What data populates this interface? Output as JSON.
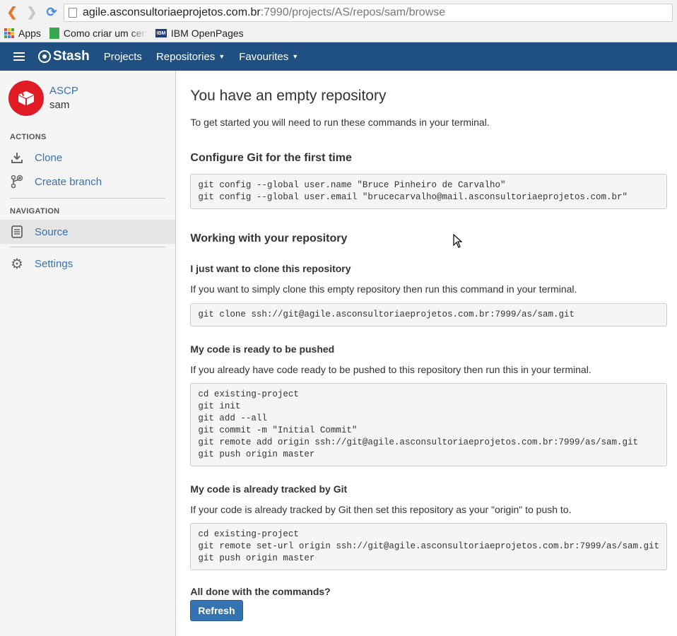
{
  "browser": {
    "url_host": "agile.asconsultoriaeprojetos.com.br",
    "url_path": ":7990/projects/AS/repos/sam/browse",
    "bookmarks": [
      {
        "label": "Apps",
        "icon": "apps-grid-icon"
      },
      {
        "label": "Como criar um cert",
        "icon": "sheets-icon"
      },
      {
        "label": "IBM OpenPages",
        "icon": "ibm-icon"
      }
    ]
  },
  "header": {
    "logo": "Stash",
    "nav": [
      {
        "label": "Projects"
      },
      {
        "label": "Repositories"
      },
      {
        "label": "Favourites"
      }
    ],
    "color": "#205081"
  },
  "sidebar": {
    "project": "ASCP",
    "repo": "sam",
    "actions_title": "ACTIONS",
    "actions": [
      {
        "label": "Clone",
        "icon": "clone-icon"
      },
      {
        "label": "Create branch",
        "icon": "create-branch-icon"
      }
    ],
    "navigation_title": "NAVIGATION",
    "navigation": [
      {
        "label": "Source",
        "icon": "source-icon",
        "active": true
      },
      {
        "label": "Settings",
        "icon": "gear-icon"
      }
    ],
    "avatar_color": "#e01b24"
  },
  "main": {
    "title": "You have an empty repository",
    "intro": "To get started you will need to run these commands in your terminal.",
    "configure": {
      "heading": "Configure Git for the first time",
      "code": "git config --global user.name \"Bruce Pinheiro de Carvalho\"\ngit config --global user.email \"brucecarvalho@mail.asconsultoriaeprojetos.com.br\""
    },
    "working_heading": "Working with your repository",
    "clone": {
      "heading": "I just want to clone this repository",
      "desc": "If you want to simply clone this empty repository then run this command in your terminal.",
      "code": "git clone ssh://git@agile.asconsultoriaeprojetos.com.br:7999/as/sam.git"
    },
    "push": {
      "heading": "My code is ready to be pushed",
      "desc": "If you already have code ready to be pushed to this repository then run this in your terminal.",
      "code": "cd existing-project\ngit init\ngit add --all\ngit commit -m \"Initial Commit\"\ngit remote add origin ssh://git@agile.asconsultoriaeprojetos.com.br:7999/as/sam.git\ngit push origin master"
    },
    "tracked": {
      "heading": "My code is already tracked by Git",
      "desc": "If your code is already tracked by Git then set this repository as your \"origin\" to push to.",
      "code": "cd existing-project\ngit remote set-url origin ssh://git@agile.asconsultoriaeprojetos.com.br:7999/as/sam.git\ngit push origin master"
    },
    "done_heading": "All done with the commands?",
    "refresh_label": "Refresh",
    "accent": "#3572b0"
  }
}
